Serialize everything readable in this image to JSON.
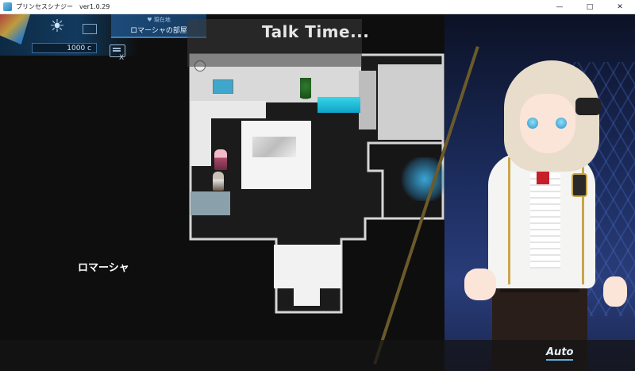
{
  "window": {
    "title": "プリンセスシナジー　ver1.0.29",
    "minimize_icon": "minimize-icon",
    "maximize_icon": "maximize-icon",
    "close_icon": "close-icon"
  },
  "hud": {
    "weather_icon": "sun-icon",
    "location_label": "♥ 現在地",
    "location_name": "ロマーシャの部屋",
    "money": "1000 c",
    "menu_icon": "menu-icon",
    "menu_hotkey": "X"
  },
  "banner": {
    "text": "Talk Time..."
  },
  "dialog": {
    "speaker": "ロマーシャ",
    "auto_label": "Auto"
  },
  "colors": {
    "hud_blue": "#123a5e",
    "accent": "#5ab0e0",
    "banner_text": "#e6e6e6"
  }
}
